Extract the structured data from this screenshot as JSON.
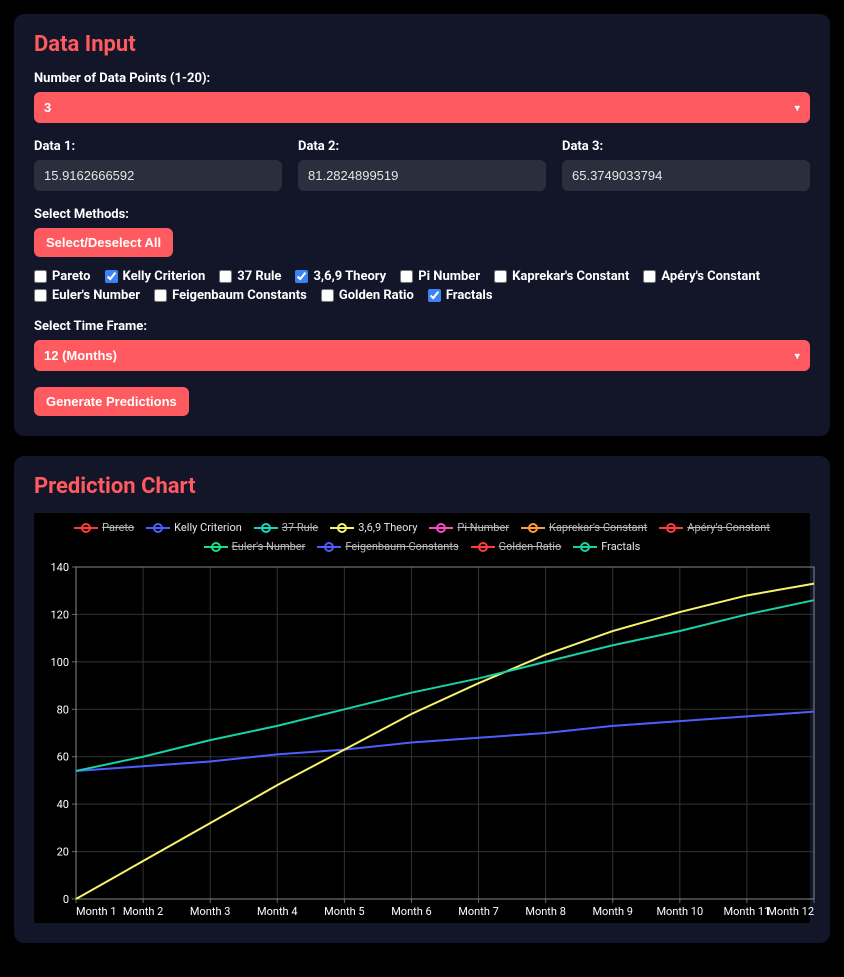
{
  "input": {
    "title": "Data Input",
    "num_label": "Number of Data Points (1-20):",
    "num_value": "3",
    "data_fields": [
      {
        "label": "Data 1:",
        "value": "15.9162666592"
      },
      {
        "label": "Data 2:",
        "value": "81.2824899519"
      },
      {
        "label": "Data 3:",
        "value": "65.3749033794"
      }
    ],
    "methods_label": "Select Methods:",
    "select_all_label": "Select/Deselect All",
    "methods": [
      {
        "name": "Pareto",
        "checked": false
      },
      {
        "name": "Kelly Criterion",
        "checked": true
      },
      {
        "name": "37 Rule",
        "checked": false
      },
      {
        "name": "3,6,9 Theory",
        "checked": true
      },
      {
        "name": "Pi Number",
        "checked": false
      },
      {
        "name": "Kaprekar's Constant",
        "checked": false
      },
      {
        "name": "Apéry's Constant",
        "checked": false
      },
      {
        "name": "Euler's Number",
        "checked": false
      },
      {
        "name": "Feigenbaum Constants",
        "checked": false
      },
      {
        "name": "Golden Ratio",
        "checked": false
      },
      {
        "name": "Fractals",
        "checked": true
      }
    ],
    "timeframe_label": "Select Time Frame:",
    "timeframe_value": "12 (Months)",
    "generate_label": "Generate Predictions"
  },
  "chart": {
    "title": "Prediction Chart",
    "legend": [
      {
        "name": "Pareto",
        "color": "#ff3b3b",
        "hidden": true
      },
      {
        "name": "Kelly Criterion",
        "color": "#4d5dff",
        "hidden": false
      },
      {
        "name": "37 Rule",
        "color": "#16d6c1",
        "hidden": true
      },
      {
        "name": "3,6,9 Theory",
        "color": "#f7f36a",
        "hidden": false
      },
      {
        "name": "Pi Number",
        "color": "#ff49c3",
        "hidden": true
      },
      {
        "name": "Kaprekar's Constant",
        "color": "#ff9a3c",
        "hidden": true
      },
      {
        "name": "Apéry's Constant",
        "color": "#ff3b3b",
        "hidden": true
      },
      {
        "name": "Euler's Number",
        "color": "#19e27d",
        "hidden": true
      },
      {
        "name": "Feigenbaum Constants",
        "color": "#4d5dff",
        "hidden": true
      },
      {
        "name": "Golden Ratio",
        "color": "#ff3b3b",
        "hidden": true
      },
      {
        "name": "Fractals",
        "color": "#17d3a6",
        "hidden": false
      }
    ]
  },
  "chart_data": {
    "type": "line",
    "xlabel": "",
    "ylabel": "",
    "ylim": [
      0,
      140
    ],
    "categories": [
      "Month 1",
      "Month 2",
      "Month 3",
      "Month 4",
      "Month 5",
      "Month 6",
      "Month 7",
      "Month 8",
      "Month 9",
      "Month 10",
      "Month 11",
      "Month 12"
    ],
    "yticks": [
      0,
      20,
      40,
      60,
      80,
      100,
      120,
      140
    ],
    "series": [
      {
        "name": "Kelly Criterion",
        "color": "#4d5dff",
        "values": [
          54,
          56,
          58,
          61,
          63,
          66,
          68,
          70,
          73,
          75,
          77,
          79
        ]
      },
      {
        "name": "3,6,9 Theory",
        "color": "#f7f36a",
        "values": [
          0,
          16,
          32,
          48,
          63,
          78,
          91,
          103,
          113,
          121,
          128,
          133
        ]
      },
      {
        "name": "Fractals",
        "color": "#17d3a6",
        "values": [
          54,
          60,
          67,
          73,
          80,
          87,
          93,
          100,
          107,
          113,
          120,
          126
        ]
      }
    ]
  }
}
